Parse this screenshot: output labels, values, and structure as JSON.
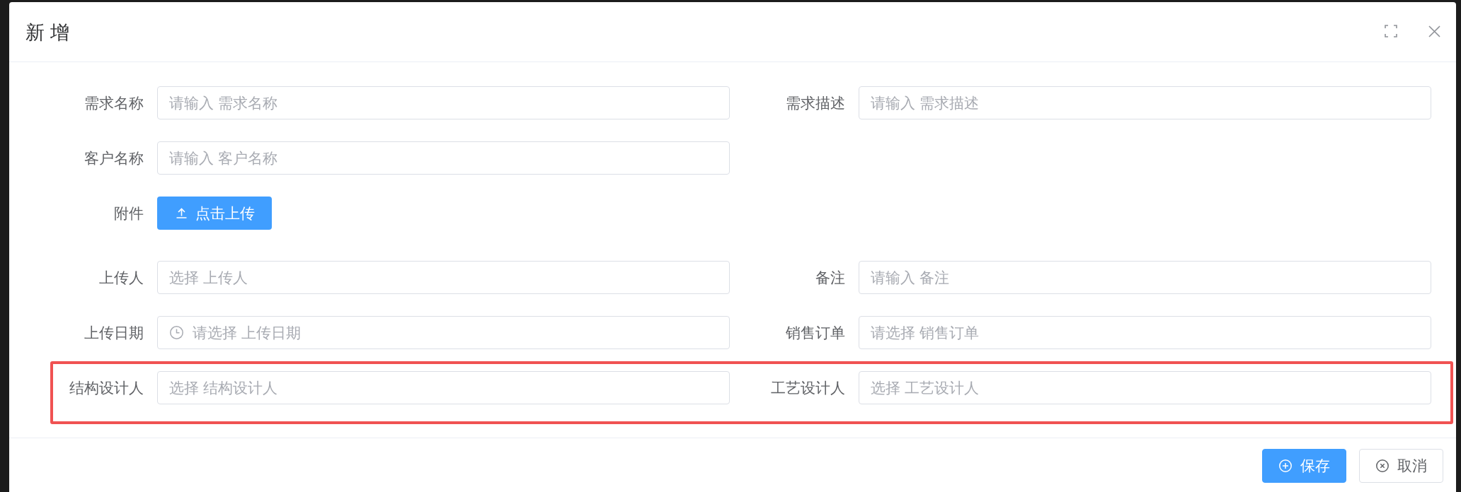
{
  "dialog": {
    "title": "新 增"
  },
  "form": {
    "rows": [
      {
        "highlighted": false,
        "items": [
          {
            "kind": "input",
            "label": "需求名称",
            "placeholder": "请输入 需求名称"
          },
          {
            "kind": "input",
            "label": "需求描述",
            "placeholder": "请输入 需求描述"
          }
        ]
      },
      {
        "highlighted": false,
        "items": [
          {
            "kind": "input",
            "label": "客户名称",
            "placeholder": "请输入 客户名称"
          }
        ]
      },
      {
        "highlighted": false,
        "items": [
          {
            "kind": "upload",
            "label": "附件",
            "button": "点击上传"
          }
        ]
      },
      {
        "highlighted": false,
        "items": [
          {
            "kind": "input",
            "label": "上传人",
            "placeholder": "选择 上传人"
          },
          {
            "kind": "input",
            "label": "备注",
            "placeholder": "请输入 备注"
          }
        ]
      },
      {
        "highlighted": false,
        "items": [
          {
            "kind": "date",
            "label": "上传日期",
            "placeholder": "请选择 上传日期"
          },
          {
            "kind": "input",
            "label": "销售订单",
            "placeholder": "请选择 销售订单"
          }
        ]
      },
      {
        "highlighted": true,
        "items": [
          {
            "kind": "input",
            "label": "结构设计人",
            "placeholder": "选择 结构设计人"
          },
          {
            "kind": "input",
            "label": "工艺设计人",
            "placeholder": "选择 工艺设计人"
          }
        ]
      }
    ]
  },
  "footer": {
    "buttons": [
      {
        "kind": "primary",
        "label": "保存"
      },
      {
        "kind": "default",
        "label": "取消"
      }
    ]
  }
}
